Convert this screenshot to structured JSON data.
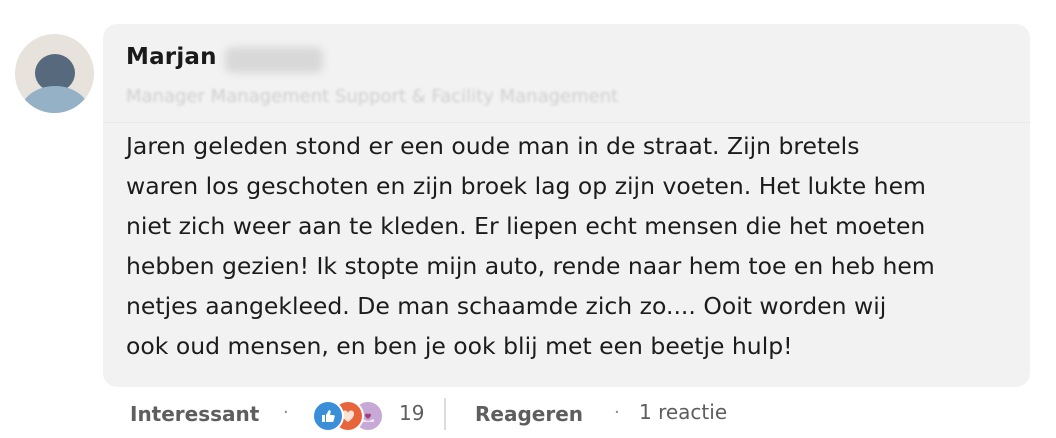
{
  "author": {
    "name": "Marjan",
    "headline": "Manager Management Support & Facility Management"
  },
  "comment": {
    "lines": [
      "Jaren geleden stond er een oude man in de straat. Zijn bretels",
      "waren los geschoten en zijn broek lag op zijn voeten. Het lukte hem",
      "niet zich weer aan te kleden. Er liepen echt mensen die het moeten",
      "hebben gezien! Ik stopte mijn auto, rende naar hem toe en heb hem",
      "netjes aangekleed. De man schaamde zich zo.... Ooit worden wij",
      "ook oud mensen, en ben je ook blij met een beetje hulp!"
    ]
  },
  "actions": {
    "react_label": "Interessant",
    "separator": "·",
    "reaction_count": "19",
    "reply_label": "Reageren",
    "replies_text": "1 reactie",
    "reaction_icons": [
      "like-icon",
      "love-icon",
      "support-icon"
    ]
  },
  "colors": {
    "bubble": "#f2f2f2",
    "like": "#3b8fd9",
    "love": "#e8643b",
    "support": "#c6a9d6"
  }
}
